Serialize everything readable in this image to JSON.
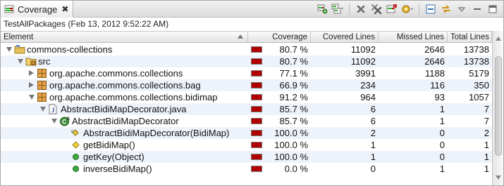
{
  "view": {
    "tab_label": "Coverage",
    "tab_close": "✖",
    "session_label": "TestAllPackages (Feb 13, 2012 9:52:22 AM)"
  },
  "toolbar": {
    "icons": [
      "relaunch-icon",
      "merge-sessions-icon",
      "remove-session-icon",
      "remove-all-sessions-icon",
      "dump-execution-data-icon",
      "select-session-icon",
      "collapse-all-icon",
      "link-with-selection-icon",
      "view-menu-icon"
    ]
  },
  "columns": {
    "element": "Element",
    "coverage": "Coverage",
    "covered": "Covered Lines",
    "missed": "Missed Lines",
    "total": "Total Lines"
  },
  "rows": [
    {
      "label": "commons-collections",
      "icon": "project-icon",
      "level": 0,
      "twisty": "open",
      "coverage": "80.7 %",
      "ratio": 0.807,
      "covered": "11092",
      "missed": "2646",
      "total": "13738"
    },
    {
      "label": "src",
      "icon": "source-folder-icon",
      "level": 1,
      "twisty": "open",
      "coverage": "80.7 %",
      "ratio": 0.807,
      "covered": "11092",
      "missed": "2646",
      "total": "13738"
    },
    {
      "label": "org.apache.commons.collections",
      "icon": "package-icon",
      "level": 2,
      "twisty": "closed",
      "coverage": "77.1 %",
      "ratio": 0.771,
      "covered": "3991",
      "missed": "1188",
      "total": "5179"
    },
    {
      "label": "org.apache.commons.collections.bag",
      "icon": "package-icon",
      "level": 2,
      "twisty": "closed",
      "coverage": "66.9 %",
      "ratio": 0.669,
      "covered": "234",
      "missed": "116",
      "total": "350"
    },
    {
      "label": "org.apache.commons.collections.bidimap",
      "icon": "package-icon",
      "level": 2,
      "twisty": "open",
      "coverage": "91.2 %",
      "ratio": 0.912,
      "covered": "964",
      "missed": "93",
      "total": "1057"
    },
    {
      "label": "AbstractBidiMapDecorator.java",
      "icon": "java-file-icon",
      "level": 3,
      "twisty": "open",
      "coverage": "85.7 %",
      "ratio": 0.857,
      "covered": "6",
      "missed": "1",
      "total": "7"
    },
    {
      "label": "AbstractBidiMapDecorator",
      "icon": "class-icon",
      "level": 4,
      "twisty": "open",
      "coverage": "85.7 %",
      "ratio": 0.857,
      "covered": "6",
      "missed": "1",
      "total": "7"
    },
    {
      "label": "AbstractBidiMapDecorator(BidiMap)",
      "icon": "constructor-icon",
      "level": 5,
      "twisty": "none",
      "coverage": "100.0 %",
      "ratio": 1.0,
      "covered": "2",
      "missed": "0",
      "total": "2"
    },
    {
      "label": "getBidiMap()",
      "icon": "protected-method-icon",
      "level": 5,
      "twisty": "none",
      "coverage": "100.0 %",
      "ratio": 1.0,
      "covered": "1",
      "missed": "0",
      "total": "1"
    },
    {
      "label": "getKey(Object)",
      "icon": "public-method-icon",
      "level": 5,
      "twisty": "none",
      "coverage": "100.0 %",
      "ratio": 1.0,
      "covered": "1",
      "missed": "0",
      "total": "1"
    },
    {
      "label": "inverseBidiMap()",
      "icon": "public-method-icon",
      "level": 5,
      "twisty": "none",
      "coverage": "0.0 %",
      "ratio": 0.0,
      "covered": "0",
      "missed": "1",
      "total": "1"
    }
  ],
  "colors": {
    "covered": "#2bb52b",
    "missed": "#b00000",
    "row_alt": "#eef3fb"
  }
}
